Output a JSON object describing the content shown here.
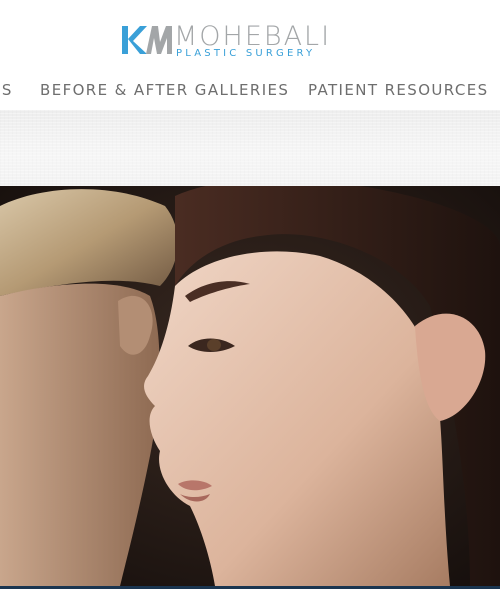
{
  "logo": {
    "mark_text": "KM",
    "name": "MOHEBALI",
    "subtitle": "PLASTIC SURGERY"
  },
  "nav": {
    "items": [
      {
        "label": "ES"
      },
      {
        "label": "BEFORE & AFTER GALLERIES"
      },
      {
        "label": "PATIENT RESOURCES"
      }
    ]
  },
  "colors": {
    "logo_blue": "#3aa0d8",
    "logo_gray": "#a3a6a8",
    "nav_text": "#6e6e6e",
    "band": "#f3f3f3",
    "bottom_strip": "#1a3550"
  },
  "hero": {
    "image": "two-women-profile-photo"
  }
}
